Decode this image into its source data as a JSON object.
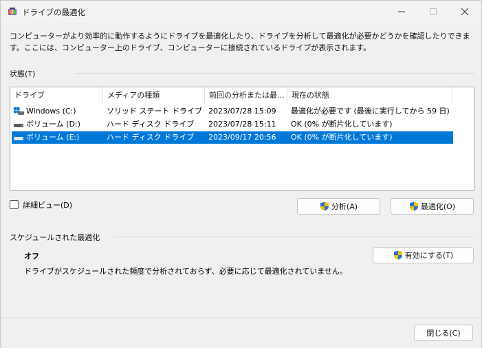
{
  "window": {
    "title": "ドライブの最適化",
    "minimize": "−",
    "maximize": "□",
    "close": "✕"
  },
  "description": "コンピューターがより効率的に動作するようにドライブを最適化したり、ドライブを分析して最適化が必要かどうかを確認したりできます。ここには、コンピューター上のドライブ、コンピューターに接続されているドライブが表示されます。",
  "status_section": {
    "label": "状態(T)"
  },
  "table": {
    "columns": [
      "ドライブ",
      "メディアの種類",
      "前回の分析または最...",
      "現在の状態"
    ],
    "rows": [
      {
        "drive": "Windows (C:)",
        "media": "ソリッド ステート ドライブ",
        "last": "2023/07/28 15:09",
        "status": "最適化が必要です (最後に実行してから 59 日)",
        "icon": "windows-drive-icon",
        "selected": false
      },
      {
        "drive": "ボリューム (D:)",
        "media": "ハード ディスク ドライブ",
        "last": "2023/07/28 15:11",
        "status": "OK (0% が断片化しています)",
        "icon": "hard-drive-icon",
        "selected": false
      },
      {
        "drive": "ボリューム (E:)",
        "media": "ハード ディスク ドライブ",
        "last": "2023/09/17 20:56",
        "status": "OK (0% が断片化しています)",
        "icon": "hard-drive-icon",
        "selected": true
      }
    ]
  },
  "detail_view": {
    "label": "詳細ビュー(D)",
    "checked": false
  },
  "buttons": {
    "analyze": "分析(A)",
    "optimize": "最適化(O)",
    "enable": "有効にする(T)",
    "close": "閉じる(C)"
  },
  "schedule_section": {
    "label": "スケジュールされた最適化",
    "state": "オフ",
    "description": "ドライブがスケジュールされた頻度で分析されておらず、必要に応じて最適化されていません。"
  },
  "colors": {
    "selection": "#0078d7",
    "shield_blue": "#2a6fd6",
    "shield_yellow": "#f2c200"
  }
}
